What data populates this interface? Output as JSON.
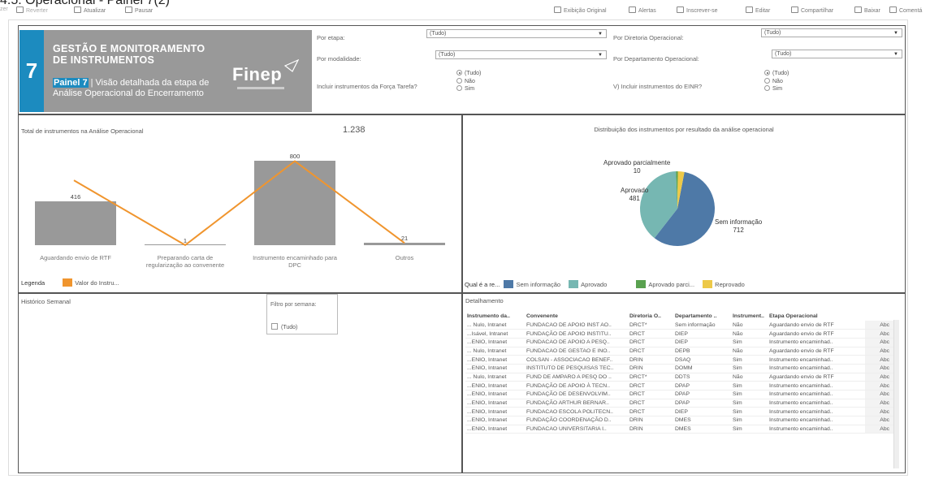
{
  "page_title": "4.5. Operacional - Painel 7(2)",
  "toolbar": {
    "left": [
      {
        "label": "zer",
        "icon": "redo-icon",
        "dim": true
      },
      {
        "label": "Reverter",
        "icon": "revert-icon",
        "dim": true
      },
      {
        "label": "Atualizar",
        "icon": "refresh-icon",
        "dim": false
      },
      {
        "label": "Pausar",
        "icon": "pause-icon",
        "dim": false
      }
    ],
    "right": [
      {
        "label": "Exibição Original",
        "icon": "original-view-icon"
      },
      {
        "label": "Alertas",
        "icon": "alert-icon"
      },
      {
        "label": "Inscrever-se",
        "icon": "subscribe-icon"
      },
      {
        "label": "Editar",
        "icon": "edit-icon"
      },
      {
        "label": "Compartilhar",
        "icon": "share-icon"
      },
      {
        "label": "Baixar",
        "icon": "download-icon"
      },
      {
        "label": "Comentá",
        "icon": "comment-icon"
      }
    ]
  },
  "banner": {
    "number": "7",
    "title_line1": "GESTÃO E MONITORAMENTO",
    "title_line2": "DE INSTRUMENTOS",
    "painel": "Painel 7",
    "subtitle": " | Visão detalhada da etapa de Análise Operacional do Encerramento",
    "logo": "Finep",
    "accent": "#1c8bbf"
  },
  "filters": {
    "por_etapa": {
      "label": "Por etapa:",
      "value": "(Tudo)"
    },
    "por_modalidade": {
      "label": "Por modalidade:",
      "value": "(Tudo)"
    },
    "forca_tarefa": {
      "label": "Incluir instrumentos da Força Tarefa?",
      "options": [
        "(Tudo)",
        "Não",
        "Sim"
      ],
      "selected": "(Tudo)"
    },
    "por_diretoria": {
      "label": "Por Diretoria Operacional:",
      "value": "(Tudo)"
    },
    "por_departamento": {
      "label": "Por Departamento Operacional:",
      "value": "(Tudo)"
    },
    "einr": {
      "label": "V) Incluir instrumentos do EINR?",
      "options": [
        "(Tudo)",
        "Não",
        "Sim"
      ],
      "selected": "(Tudo)"
    }
  },
  "total_panel": {
    "title": "Total de instrumentos na Análise Operacional",
    "total": "1.238",
    "legend_label": "Legenda",
    "legend_item": "Valor do Instru...",
    "line_color": "#f0952e",
    "bar_color": "#999999"
  },
  "chart_data": [
    {
      "type": "bar",
      "categories": [
        "Aguardando envio de RTF",
        "Preparando carta de regularização ao convenente",
        "Instrumento encaminhado para DPC",
        "Outros"
      ],
      "values": [
        416,
        1,
        800,
        21
      ],
      "line_values": [
        416,
        1,
        800,
        21
      ],
      "value_labels": [
        "416",
        "1",
        "800",
        "21"
      ],
      "ylim": [
        0,
        850
      ]
    },
    {
      "type": "pie",
      "title": "Distribuição dos instrumentos por resultado da análise operacional",
      "slices": [
        {
          "name": "Sem informação",
          "value": 712,
          "color": "#4e79a7"
        },
        {
          "name": "Aprovado",
          "value": 481,
          "color": "#76b7b2"
        },
        {
          "name": "Aprovado parcialmente",
          "value": 10,
          "color": "#59a14f"
        },
        {
          "name": "Reprovado",
          "value": 35,
          "color": "#edc948"
        }
      ],
      "labels": [
        {
          "name": "Aprovado parcialmente",
          "value": "10"
        },
        {
          "name": "Aprovado",
          "value": "481"
        },
        {
          "name": "Sem informação",
          "value": "712"
        }
      ],
      "legend_title": "Qual é a re...",
      "legend": [
        "Sem informação",
        "Aprovado",
        "Aprovado parci...",
        "Reprovado"
      ]
    }
  ],
  "historico": {
    "title": "Histórico Semanal",
    "filter_title": "Filtro por semana:",
    "filter_option": "(Tudo)"
  },
  "detalhamento": {
    "title": "Detalhamento",
    "columns": [
      "Instrumento da..",
      "Convenente",
      "Diretoria O..",
      "Departamento ..",
      "Instrument..",
      "Etapa Operacional",
      ""
    ],
    "rows": [
      [
        "... Nulo, Intranet",
        "FUNDACAO DE APOIO INST AO..",
        "DRCT*",
        "Sem informação",
        "Não",
        "Aguardando envio de RTF",
        "Abc"
      ],
      [
        "...Isável, Intranet",
        "FUNDAÇÃO DE APOIO INSTITU..",
        "DRCT",
        "DIEP",
        "Não",
        "Aguardando envio de RTF",
        "Abc"
      ],
      [
        "...ENIO, Intranet",
        "FUNDACAO DE APOIO A PESQ..",
        "DRCT",
        "DIEP",
        "Sim",
        "Instrumento encaminhad..",
        "Abc"
      ],
      [
        "... Nulo, Intranet",
        "FUNDACAO DE GESTAO E INO..",
        "DRCT",
        "DEPB",
        "Não",
        "Aguardando envio de RTF",
        "Abc"
      ],
      [
        "...ENIO, Intranet",
        "COLSAN - ASSOCIACAO BENEF..",
        "DRIN",
        "DSAQ",
        "Sim",
        "Instrumento encaminhad..",
        "Abc"
      ],
      [
        "...ENIO, Intranet",
        "INSTITUTO DE PESQUISAS TEC..",
        "DRIN",
        "DOMM",
        "Sim",
        "Instrumento encaminhad..",
        "Abc"
      ],
      [
        "... Nulo, Intranet",
        "FUND DE AMPARO A PESQ DO ..",
        "DRCT*",
        "DDTS",
        "Não",
        "Aguardando envio de RTF",
        "Abc"
      ],
      [
        "...ENIO, Intranet",
        "FUNDAÇÃO DE APOIO À TECN..",
        "DRCT",
        "DPAP",
        "Sim",
        "Instrumento encaminhad..",
        "Abc"
      ],
      [
        "...ENIO, Intranet",
        "FUNDAÇÃO DE DESENVOLVIM..",
        "DRCT",
        "DPAP",
        "Sim",
        "Instrumento encaminhad..",
        "Abc"
      ],
      [
        "...ENIO, Intranet",
        "FUNDAÇÃO ARTHUR BERNAR..",
        "DRCT",
        "DPAP",
        "Sim",
        "Instrumento encaminhad..",
        "Abc"
      ],
      [
        "...ENIO, Intranet",
        "FUNDACAO ESCOLA POLITECN..",
        "DRCT",
        "DIEP",
        "Sim",
        "Instrumento encaminhad..",
        "Abc"
      ],
      [
        "...ENIO, Intranet",
        "FUNDAÇÃO COORDENAÇÃO D..",
        "DRIN",
        "DMES",
        "Sim",
        "Instrumento encaminhad..",
        "Abc"
      ],
      [
        "...ENIO, Intranet",
        "FUNDACAO UNIVERSITARIA I..",
        "DRIN",
        "DMES",
        "Sim",
        "Instrumento encaminhad..",
        "Abc"
      ]
    ]
  }
}
